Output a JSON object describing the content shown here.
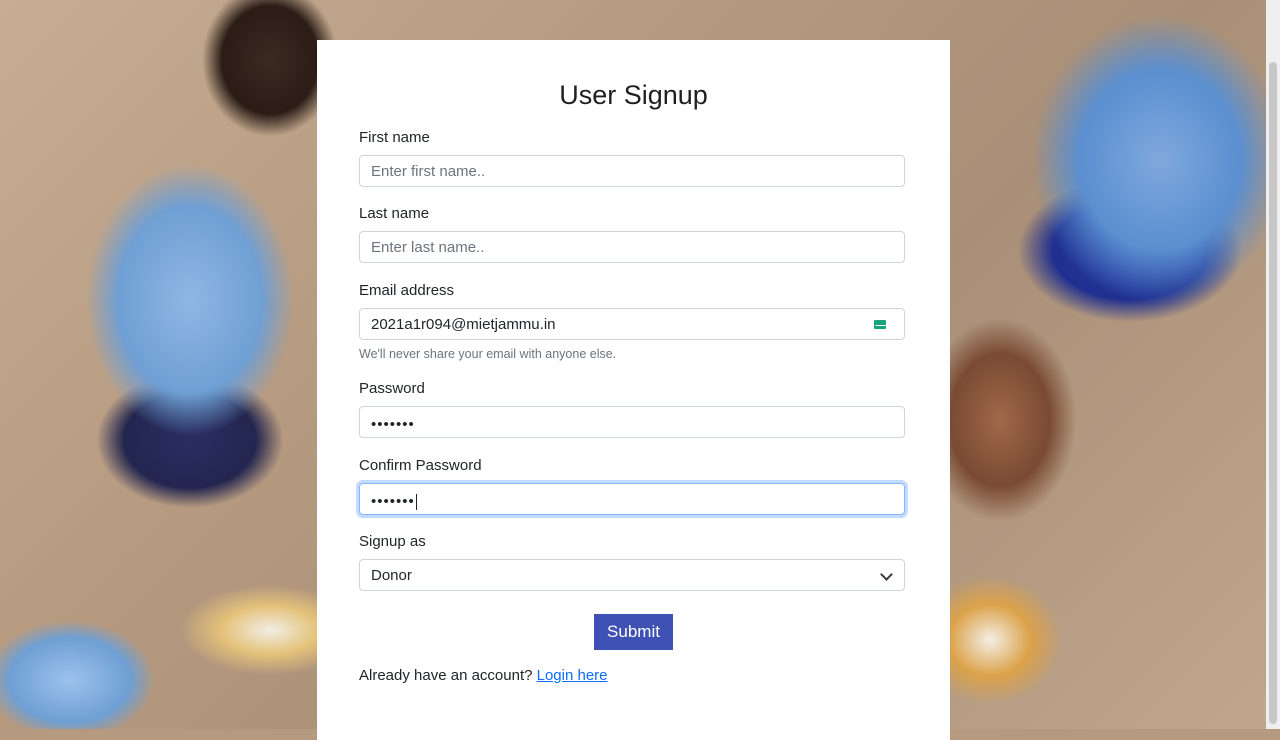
{
  "form": {
    "title": "User Signup",
    "first_name": {
      "label": "First name",
      "placeholder": "Enter first name.."
    },
    "last_name": {
      "label": "Last name",
      "placeholder": "Enter last name.."
    },
    "email": {
      "label": "Email address",
      "value": "2021a1r094@mietjammu.in",
      "help": "We'll never share your email with anyone else."
    },
    "password": {
      "label": "Password",
      "value": "•••••••"
    },
    "confirm_password": {
      "label": "Confirm Password",
      "value": "•••••••"
    },
    "signup_as": {
      "label": "Signup as",
      "selected": "Donor"
    },
    "submit_label": "Submit",
    "footer": {
      "prompt": "Already have an account?",
      "link": "Login here"
    }
  },
  "icons": {
    "email_field_icon": "mail-icon",
    "select_indicator": "chevron-down-icon"
  },
  "colors": {
    "primary": "#3f51b5",
    "link": "#0d6efd",
    "focus": "#86b7fe"
  }
}
